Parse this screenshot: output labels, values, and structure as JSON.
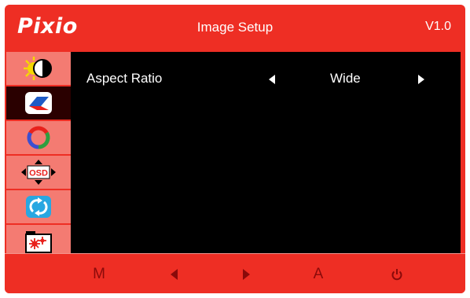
{
  "header": {
    "logo": "Pixio",
    "title": "Image Setup",
    "version": "V1.0"
  },
  "sidebar": {
    "selected_index": 1,
    "items": [
      {
        "icon": "brightness-contrast-icon"
      },
      {
        "icon": "image-setup-icon"
      },
      {
        "icon": "color-setting-icon"
      },
      {
        "icon": "osd-setting-icon"
      },
      {
        "icon": "reset-icon"
      },
      {
        "icon": "misc-setting-icon"
      }
    ]
  },
  "settings": [
    {
      "label": "Aspect Ratio",
      "value": "Wide"
    }
  ],
  "footer": {
    "menu_label": "M",
    "auto_label": "A",
    "left_icon": "left-arrow-icon",
    "right_icon": "right-arrow-icon",
    "power_icon": "power-icon"
  },
  "colors": {
    "frame": "#ee2e24",
    "sidebar": "#f47b72",
    "selected": "#2a0000",
    "content": "#000000",
    "footer_text": "#8a0a0a"
  }
}
